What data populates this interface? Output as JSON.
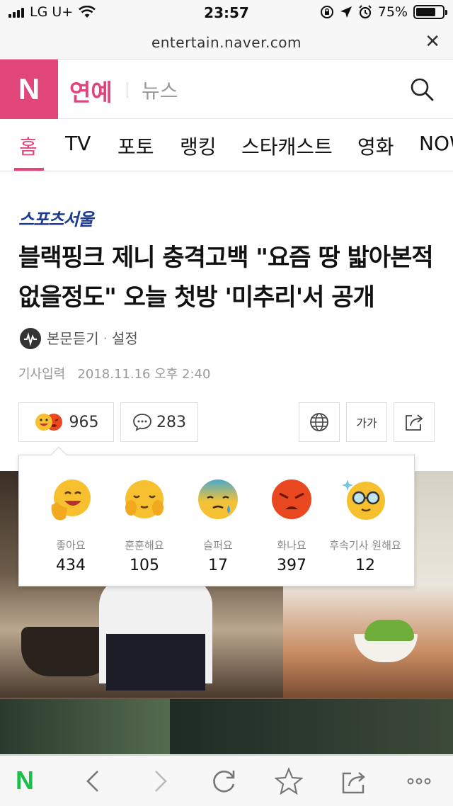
{
  "status_bar": {
    "carrier": "LG U+",
    "time": "23:57",
    "battery_percent": "75%",
    "battery_level": 0.75
  },
  "url_bar": {
    "url": "entertain.naver.com",
    "close_icon": "close-icon"
  },
  "header": {
    "logo": "N",
    "section": "연예",
    "subsection": "뉴스",
    "search_icon": "search-icon"
  },
  "tabs": [
    {
      "label": "홈",
      "active": true
    },
    {
      "label": "TV",
      "active": false
    },
    {
      "label": "포토",
      "active": false
    },
    {
      "label": "랭킹",
      "active": false
    },
    {
      "label": "스타캐스트",
      "active": false
    },
    {
      "label": "영화",
      "active": false
    },
    {
      "label": "NOW",
      "active": false
    }
  ],
  "article": {
    "source": "스포츠서울",
    "headline": "블랙핑크 제니 충격고백 \"요즘 땅 밟아본적 없을정도\" 오늘 첫방 '미추리'서 공개",
    "listen_label": "본문듣기",
    "settings_label": "설정",
    "date_label": "기사입력",
    "date": "2018.11.16 오후 2:40"
  },
  "actions": {
    "reaction_count": "965",
    "comment_count": "283",
    "font_label": "가가",
    "globe_icon": "globe-icon",
    "share_icon": "share-icon"
  },
  "reactions": [
    {
      "label": "좋아요",
      "count": "434",
      "icon": "like-face-icon"
    },
    {
      "label": "훈훈해요",
      "count": "105",
      "icon": "warm-face-icon"
    },
    {
      "label": "슬퍼요",
      "count": "17",
      "icon": "sad-face-icon"
    },
    {
      "label": "화나요",
      "count": "397",
      "icon": "angry-face-icon"
    },
    {
      "label": "후속기사 원해요",
      "count": "12",
      "icon": "want-more-face-icon"
    }
  ],
  "toolbar": {
    "home_logo": "N",
    "items": [
      "back-icon",
      "forward-icon",
      "refresh-icon",
      "bookmark-icon",
      "share-icon",
      "more-icon"
    ]
  },
  "colors": {
    "brand_pink": "#e0467a",
    "naver_green": "#19c14a",
    "source_blue": "#1d3a8f"
  }
}
